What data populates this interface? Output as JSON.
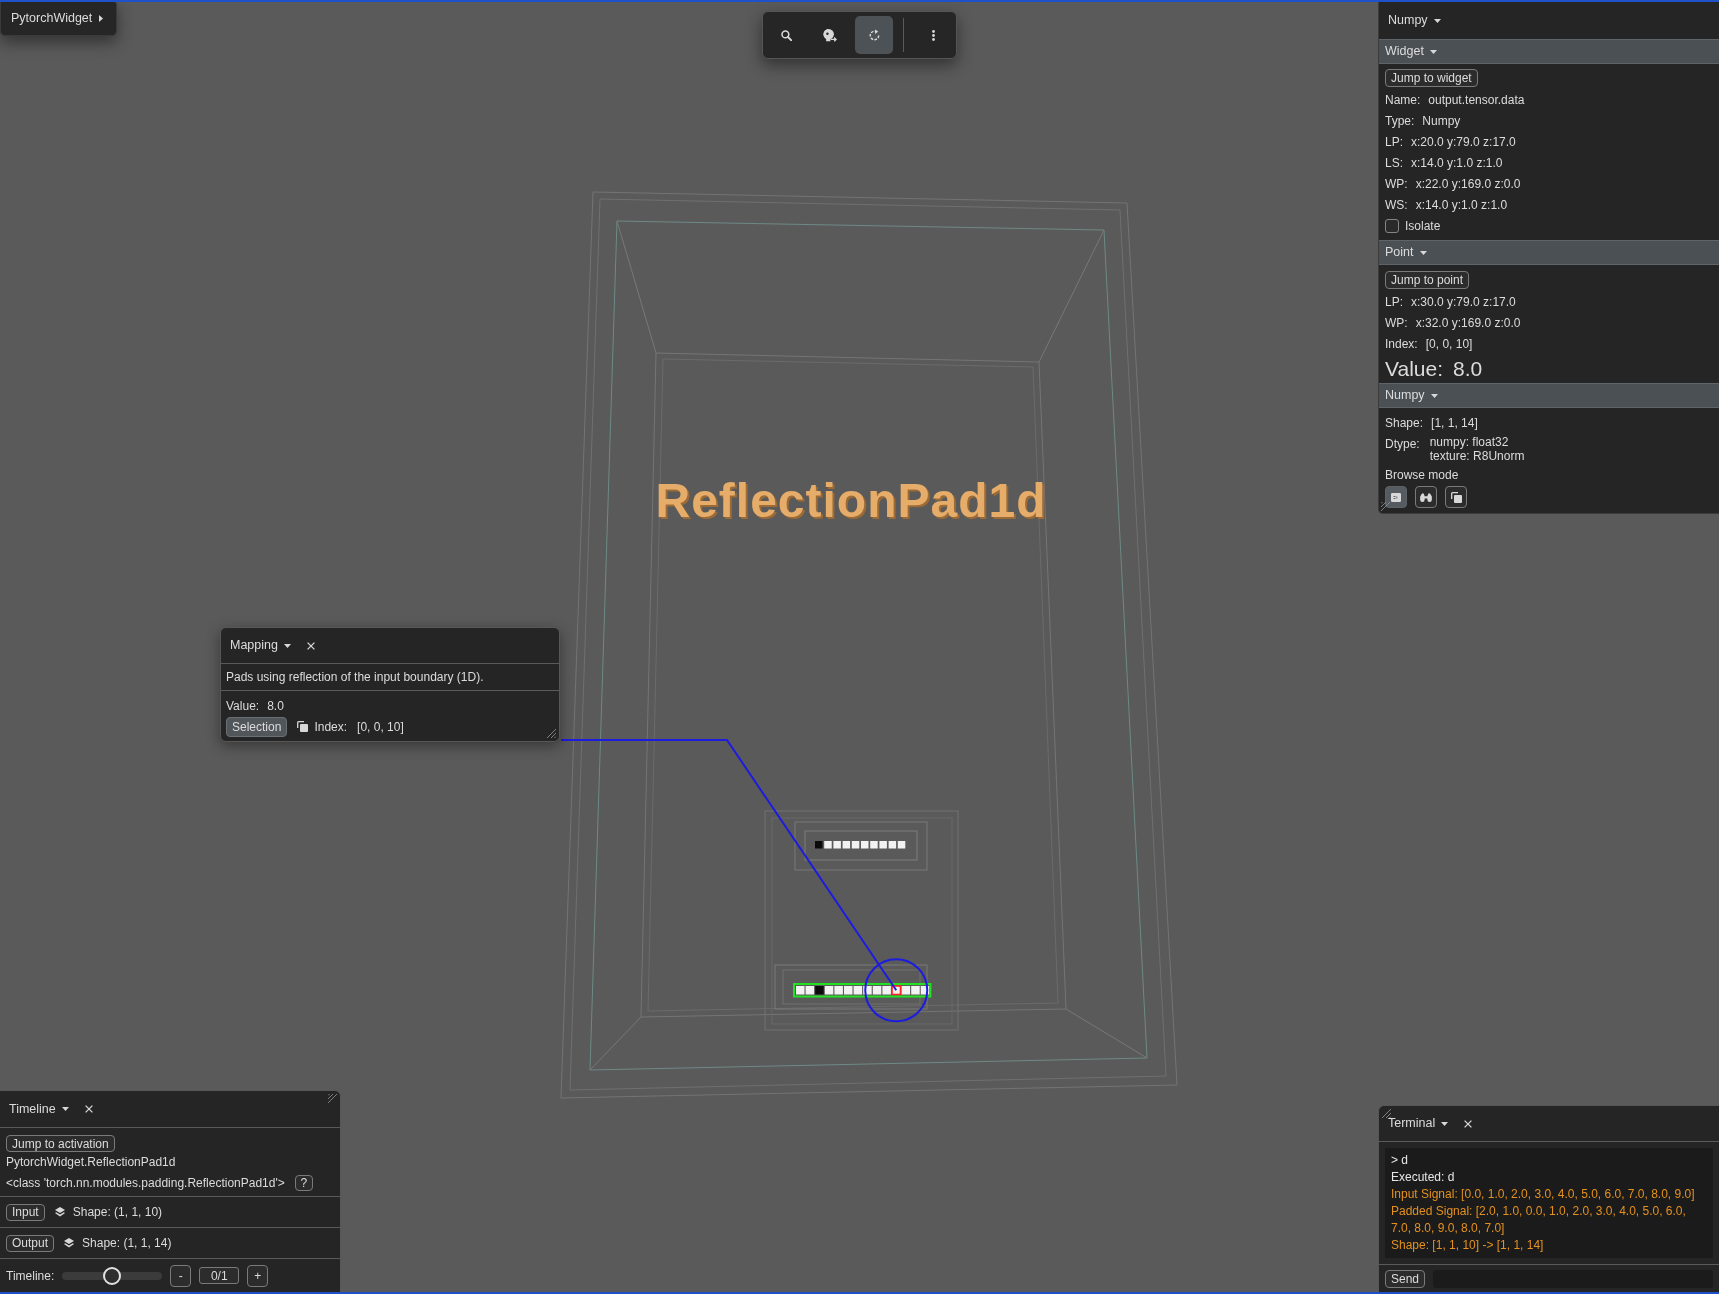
{
  "top_menu": {
    "label": "PytorchWidget",
    "expanded": false
  },
  "toolbar": {
    "tools": [
      {
        "kind": "search",
        "selected": false
      },
      {
        "kind": "focus",
        "selected": false
      },
      {
        "kind": "rotate",
        "selected": true
      }
    ]
  },
  "scene": {
    "title": "ReflectionPad1d",
    "input_tensor": {
      "cells": [
        {
          "dark": true,
          "selected": false
        },
        {
          "dark": false,
          "selected": false
        },
        {
          "dark": false,
          "selected": false
        },
        {
          "dark": false,
          "selected": false
        },
        {
          "dark": false,
          "selected": false
        },
        {
          "dark": false,
          "selected": false
        },
        {
          "dark": false,
          "selected": false
        },
        {
          "dark": false,
          "selected": false
        },
        {
          "dark": false,
          "selected": false
        },
        {
          "dark": false,
          "selected": false
        }
      ]
    },
    "output_tensor": {
      "selected": true,
      "cells": [
        {
          "dark": false,
          "selected": false
        },
        {
          "dark": false,
          "selected": false
        },
        {
          "dark": true,
          "selected": false
        },
        {
          "dark": false,
          "selected": false
        },
        {
          "dark": false,
          "selected": false
        },
        {
          "dark": false,
          "selected": false
        },
        {
          "dark": false,
          "selected": false
        },
        {
          "dark": false,
          "selected": false
        },
        {
          "dark": false,
          "selected": false
        },
        {
          "dark": false,
          "selected": false
        },
        {
          "dark": false,
          "selected": true
        },
        {
          "dark": false,
          "selected": false
        },
        {
          "dark": false,
          "selected": false
        },
        {
          "dark": false,
          "selected": false
        }
      ]
    }
  },
  "inspector": {
    "title": "Numpy",
    "widget": {
      "title": "Widget",
      "expanded": true,
      "button": "Jump to widget",
      "fields": [
        {
          "label": "Name:",
          "value": "output.tensor.data"
        },
        {
          "label": "Type:",
          "value": "Numpy"
        },
        {
          "label": "LP:",
          "value": "x:20.0 y:79.0 z:17.0"
        },
        {
          "label": "LS:",
          "value": "x:14.0 y:1.0 z:1.0"
        },
        {
          "label": "WP:",
          "value": "x:22.0 y:169.0 z:0.0"
        },
        {
          "label": "WS:",
          "value": "x:14.0 y:1.0 z:1.0"
        }
      ],
      "isolate": {
        "label": "Isolate",
        "checked": false
      }
    },
    "point": {
      "title": "Point",
      "expanded": true,
      "button": "Jump to point",
      "fields": [
        {
          "label": "LP:",
          "value": "x:30.0 y:79.0 z:17.0"
        },
        {
          "label": "WP:",
          "value": "x:32.0 y:169.0 z:0.0"
        },
        {
          "label": "Index:",
          "value": "[0, 0, 10]"
        }
      ],
      "value": {
        "label": "Value:",
        "value": "8.0"
      }
    },
    "numpy": {
      "title": "Numpy",
      "expanded": true,
      "fields": [
        {
          "label": "Shape:",
          "value": "[1, 1, 14]"
        },
        {
          "label": "Dtype:",
          "value_lines": [
            "numpy: float32",
            "texture: R8Unorm"
          ]
        }
      ],
      "browse_mode": {
        "label": "Browse mode",
        "modes": [
          {
            "kind": "flat",
            "selected": true
          },
          {
            "kind": "explore",
            "selected": false
          },
          {
            "kind": "stack",
            "selected": false
          }
        ]
      }
    }
  },
  "mapping": {
    "title": "Mapping",
    "description": "Pads using reflection of the input boundary (1D).",
    "value": {
      "label": "Value:",
      "value": "8.0"
    },
    "selection_button": {
      "label": "Selection",
      "selected": true
    },
    "index": {
      "label": "Index:",
      "value": "[0, 0, 10]"
    }
  },
  "timeline": {
    "title": "Timeline",
    "jump_button": "Jump to activation",
    "module": "PytorchWidget.ReflectionPad1d",
    "class_name": "<class 'torch.nn.modules.padding.ReflectionPad1d'>",
    "help_button": "?",
    "tensors": [
      {
        "button": "Input",
        "shape": "Shape: (1, 1, 10)"
      },
      {
        "button": "Output",
        "shape": "Shape: (1, 1, 14)"
      }
    ],
    "slider": {
      "label": "Timeline:",
      "level": 0.5,
      "minus": "-",
      "counter": "0/1",
      "plus": "+"
    }
  },
  "terminal": {
    "title": "Terminal",
    "lines": [
      {
        "kind": "echo",
        "text": "> d"
      },
      {
        "kind": "info",
        "text": "Executed: d"
      },
      {
        "kind": "output",
        "text": "Input Signal: [0.0, 1.0, 2.0, 3.0, 4.0, 5.0, 6.0, 7.0, 8.0, 9.0]"
      },
      {
        "kind": "output",
        "text": "Padded Signal: [2.0, 1.0, 0.0, 1.0, 2.0, 3.0, 4.0, 5.0, 6.0, 7.0, 8.0, 9.0, 8.0, 7.0]"
      },
      {
        "kind": "output",
        "text": "Shape: [1, 1, 10] -> [1, 1, 14]"
      }
    ],
    "send_button": "Send"
  }
}
